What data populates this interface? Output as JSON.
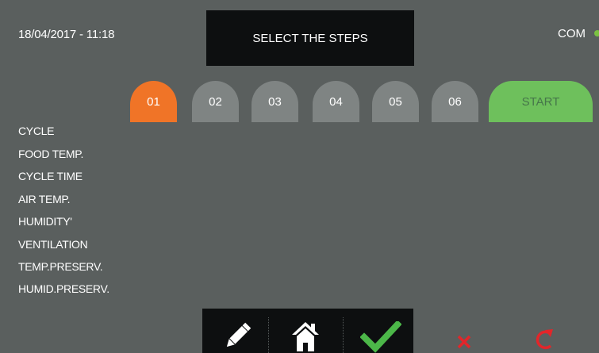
{
  "header": {
    "datetime": "18/04/2017 - 11:18",
    "title": "SELECT THE STEPS",
    "com_label": "COM",
    "com_status_color": "#7cc142"
  },
  "steps": {
    "items": [
      {
        "label": "01",
        "active": true
      },
      {
        "label": "02",
        "active": false
      },
      {
        "label": "03",
        "active": false
      },
      {
        "label": "04",
        "active": false
      },
      {
        "label": "05",
        "active": false
      },
      {
        "label": "06",
        "active": false
      }
    ],
    "start_label": "START"
  },
  "parameters": [
    "CYCLE",
    "FOOD TEMP.",
    "CYCLE TIME",
    "AIR TEMP.",
    "HUMIDITY'",
    "VENTILATION",
    "TEMP.PRESERV.",
    "HUMID.PRESERV."
  ],
  "toolbar": {
    "icons": [
      "pencil-icon",
      "home-icon",
      "checkmark-icon",
      "cancel-x-icon",
      "reset-arrow-icon"
    ],
    "colors": {
      "active_step": "#f07427",
      "start": "#6ec05c",
      "confirm": "#4cb749",
      "cancel": "#e2262a"
    }
  }
}
